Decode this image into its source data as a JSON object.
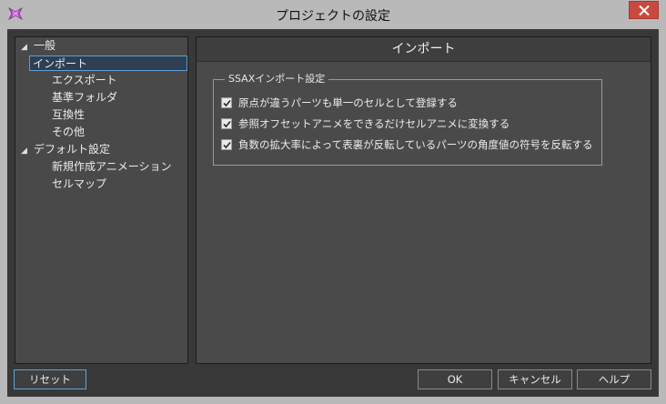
{
  "window": {
    "title": "プロジェクトの設定"
  },
  "tree": {
    "items": [
      {
        "label": "一般",
        "expanded": true,
        "level": 0
      },
      {
        "label": "インポート",
        "selected": true,
        "level": 1
      },
      {
        "label": "エクスポート",
        "level": 1
      },
      {
        "label": "基準フォルダ",
        "level": 1
      },
      {
        "label": "互換性",
        "level": 1
      },
      {
        "label": "その他",
        "level": 1
      },
      {
        "label": "デフォルト設定",
        "expanded": true,
        "level": 0
      },
      {
        "label": "新規作成アニメーション",
        "level": 1
      },
      {
        "label": "セルマップ",
        "level": 1
      }
    ]
  },
  "content": {
    "header": "インポート",
    "group_title": "SSAXインポート設定",
    "options": [
      {
        "label": "原点が違うパーツも単一のセルとして登録する",
        "checked": true
      },
      {
        "label": "参照オフセットアニメをできるだけセルアニメに変換する",
        "checked": true
      },
      {
        "label": "負数の拡大率によって表裏が反転しているパーツの角度値の符号を反転する",
        "checked": true
      }
    ]
  },
  "buttons": {
    "reset": "リセット",
    "ok": "OK",
    "cancel": "キャンセル",
    "help": "ヘルプ"
  },
  "colors": {
    "close_button": "#c84a3e",
    "selection_border": "#5aa0d6",
    "panel_bg": "#4a4a4a",
    "window_bg": "#383838"
  }
}
